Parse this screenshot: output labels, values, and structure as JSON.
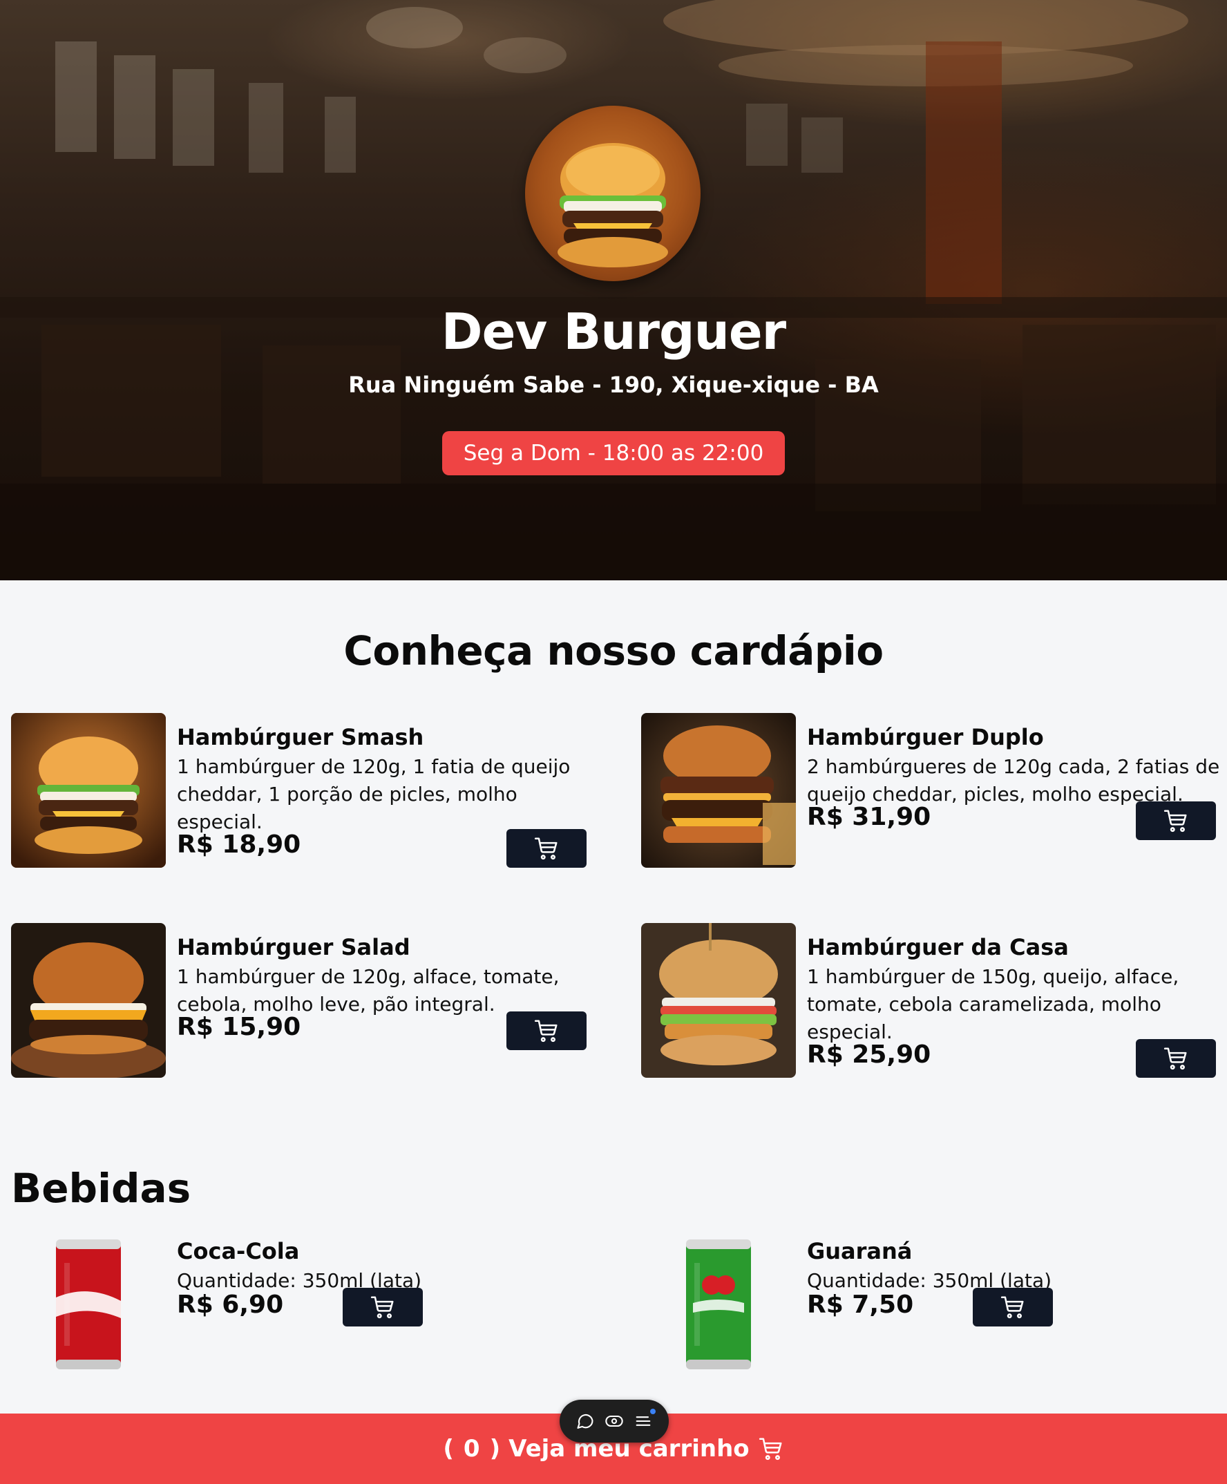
{
  "hero": {
    "title": "Dev Burguer",
    "address": "Rua Ninguém Sabe - 190, Xique-xique - BA",
    "hours": "Seg a Dom - 18:00 as 22:00",
    "logo_icon": "burger-logo"
  },
  "menu": {
    "title": "Conheça nosso cardápio",
    "items": [
      {
        "name": "Hambúrguer Smash",
        "description": "1 hambúrguer de 120g, 1 fatia de queijo cheddar, 1 porção de picles, molho especial.",
        "price": "R$ 18,90"
      },
      {
        "name": "Hambúrguer Duplo",
        "description": "2 hambúrgueres de 120g cada, 2 fatias de queijo cheddar, picles, molho especial.",
        "price": "R$ 31,90"
      },
      {
        "name": "Hambúrguer Salad",
        "description": "1 hambúrguer de 120g, alface, tomate, cebola, molho leve, pão integral.",
        "price": "R$ 15,90"
      },
      {
        "name": "Hambúrguer da Casa",
        "description": "1 hambúrguer de 150g, queijo, alface, tomate, cebola caramelizada, molho especial.",
        "price": "R$ 25,90"
      }
    ]
  },
  "drinks": {
    "title": "Bebidas",
    "items": [
      {
        "name": "Coca-Cola",
        "description": "Quantidade: 350ml (lata)",
        "price": "R$ 6,90"
      },
      {
        "name": "Guaraná",
        "description": "Quantidade: 350ml (lata)",
        "price": "R$ 7,50"
      }
    ]
  },
  "cart_bar": {
    "open_paren": "(",
    "count": "0",
    "close_paren": ")",
    "label": "Veja meu carrinho",
    "icon": "cart-icon"
  },
  "toolbar": {
    "icons": [
      "chat-icon",
      "eye-icon",
      "menu-icon"
    ]
  },
  "colors": {
    "accent": "#ef4444",
    "button_dark": "#111827",
    "background": "#f5f6f8"
  }
}
